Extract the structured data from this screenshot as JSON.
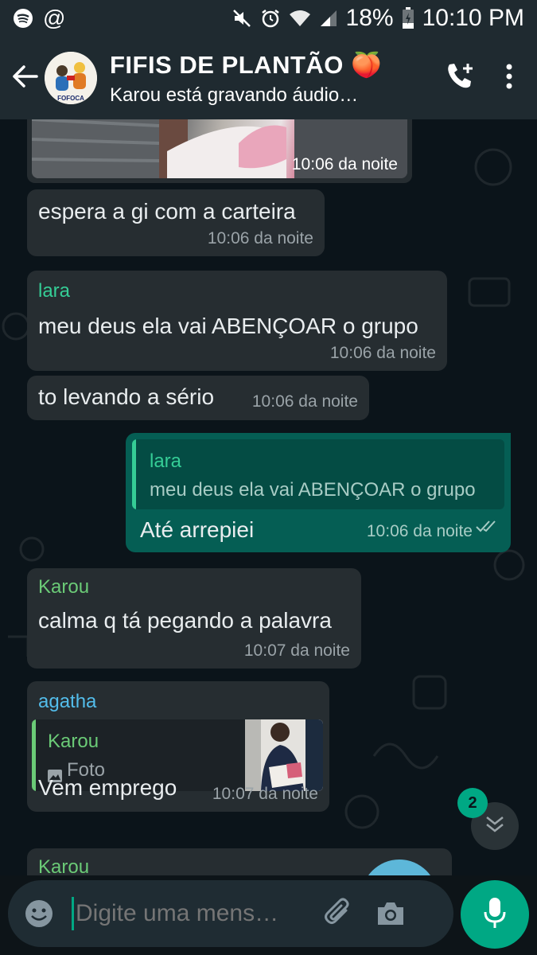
{
  "status_bar": {
    "battery": "18%",
    "time": "10:10 PM",
    "left_icons": [
      "spotify-icon",
      "at-icon"
    ],
    "right_icons": [
      "mute-icon",
      "alarm-icon",
      "wifi-icon",
      "signal-icon",
      "battery-icon"
    ]
  },
  "header": {
    "title": "FIFIS DE PLANTÃO 🍑",
    "subtitle": "Karou está gravando áudio…",
    "avatar_label": "FOFOCA"
  },
  "messages": [
    {
      "time": "10:06 da noite"
    },
    {
      "text": "espera a gi com a carteira",
      "time": "10:06 da noite"
    },
    {
      "sender": "lara",
      "text": "meu deus ela vai ABENÇOAR o grupo",
      "time": "10:06 da noite"
    },
    {
      "text": "to levando a sério",
      "time": "10:06 da noite"
    },
    {
      "quote_sender": "lara",
      "quote_text": "meu deus ela vai ABENÇOAR o grupo",
      "text": "Até arrepiei",
      "time": "10:06 da noite"
    },
    {
      "sender": "Karou",
      "text": "calma q tá pegando a palavra",
      "time": "10:07 da noite"
    },
    {
      "sender": "agatha",
      "quote_sender": "Karou",
      "quote_text": "Foto",
      "text": "Vem emprego",
      "time": "10:07 da noite"
    },
    {
      "sender": "Karou"
    }
  ],
  "scroll": {
    "unread_count": "2"
  },
  "input": {
    "placeholder": "Digite uma mens…"
  },
  "colors": {
    "header_bg": "#1f2a30",
    "incoming_bubble": "#262d31",
    "outgoing_bubble": "#055e54",
    "accent": "#00a884"
  }
}
